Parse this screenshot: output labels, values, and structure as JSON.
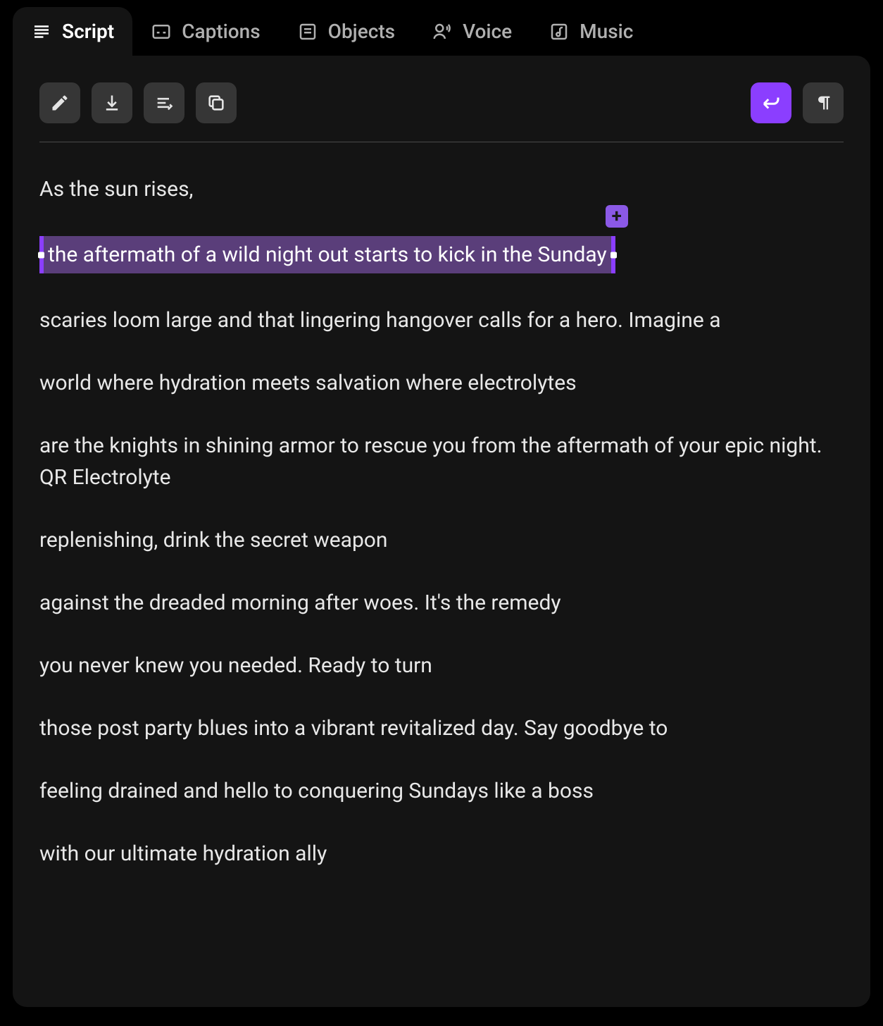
{
  "tabs": [
    {
      "label": "Script",
      "icon": "script-icon",
      "active": true
    },
    {
      "label": "Captions",
      "icon": "captions-icon",
      "active": false
    },
    {
      "label": "Objects",
      "icon": "objects-icon",
      "active": false
    },
    {
      "label": "Voice",
      "icon": "voice-icon",
      "active": false
    },
    {
      "label": "Music",
      "icon": "music-icon",
      "active": false
    }
  ],
  "toolbar": {
    "edit": "edit-icon",
    "download": "download-icon",
    "format": "format-icon",
    "copy": "copy-icon",
    "return": "return-icon",
    "paragraph": "paragraph-icon"
  },
  "selection": {
    "text": "the aftermath of a wild night out starts to kick in the Sunday",
    "add_label": "+"
  },
  "script_lines": [
    "As the sun rises,",
    "the aftermath of a wild night out starts to kick in the Sunday",
    "scaries loom large and that lingering hangover calls for a hero. Imagine a",
    "world where hydration meets salvation where electrolytes",
    "are the knights in shining armor to rescue you from the aftermath of your epic night. QR Electrolyte",
    "replenishing, drink the secret weapon",
    "against the dreaded morning after woes. It's the remedy",
    "you never knew you needed. Ready to turn",
    "those post party blues into a vibrant revitalized day. Say goodbye to",
    "feeling drained and hello to conquering Sundays like a boss",
    "with our ultimate hydration ally"
  ]
}
